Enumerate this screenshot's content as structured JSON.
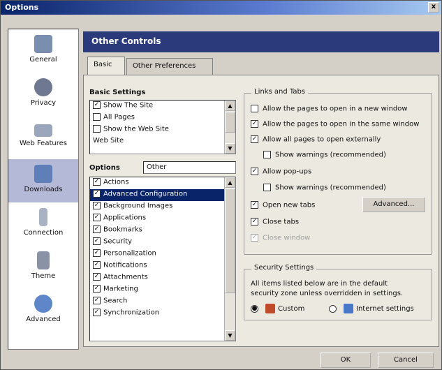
{
  "window": {
    "title": "Options",
    "close_glyph": "x"
  },
  "nav": {
    "items": [
      {
        "label": "General",
        "icon": "general-icon"
      },
      {
        "label": "Privacy",
        "icon": "privacy-icon"
      },
      {
        "label": "Web Features",
        "icon": "web-features-icon"
      },
      {
        "label": "Downloads",
        "icon": "downloads-icon",
        "selected": true
      },
      {
        "label": "Connection",
        "icon": "connection-icon"
      },
      {
        "label": "Theme",
        "icon": "theme-icon"
      },
      {
        "label": "Advanced",
        "icon": "advanced-icon"
      }
    ]
  },
  "header": {
    "title": "Other Controls"
  },
  "tabs": [
    {
      "label": "Basic"
    },
    {
      "label": "Other Preferences"
    }
  ],
  "left_section": {
    "basic_label": "Basic Settings",
    "basic_items": [
      {
        "label": "Show The Site",
        "checked": true
      },
      {
        "label": "All Pages",
        "checked": false
      },
      {
        "label": "Show the Web Site",
        "checked": false
      },
      {
        "label": "Web Site",
        "checked": false
      }
    ],
    "filter_label": "Options",
    "filter_value": "Other",
    "list_items": [
      {
        "label": "Actions",
        "checked": true
      },
      {
        "label": "Advanced Configuration",
        "checked": true,
        "selected": true
      },
      {
        "label": "Background Images",
        "checked": true
      },
      {
        "label": "Applications",
        "checked": true
      },
      {
        "label": "Bookmarks",
        "checked": true
      },
      {
        "label": "Security",
        "checked": true
      },
      {
        "label": "Personalization",
        "checked": true
      },
      {
        "label": "Notifications",
        "checked": true
      },
      {
        "label": "Attachments",
        "checked": true
      },
      {
        "label": "Marketing",
        "checked": true
      },
      {
        "label": "Search",
        "checked": true
      },
      {
        "label": "Synchronization",
        "checked": true
      }
    ]
  },
  "right_section": {
    "group1_label": "Links and Tabs",
    "options": [
      {
        "label": "Allow the pages to open in a new window",
        "checked": false,
        "indent": false,
        "disabled": false
      },
      {
        "label": "Allow the pages to open in the same window",
        "checked": true,
        "indent": false,
        "disabled": false
      },
      {
        "label": "Allow all pages to open externally",
        "checked": true,
        "indent": false,
        "disabled": false
      },
      {
        "label": "Show warnings (recommended)",
        "checked": false,
        "indent": true,
        "disabled": false
      },
      {
        "label": "Allow pop-ups",
        "checked": true,
        "indent": false,
        "disabled": false
      },
      {
        "label": "Show warnings (recommended)",
        "checked": false,
        "indent": true,
        "disabled": false
      },
      {
        "label": "Open new tabs",
        "checked": true,
        "indent": false,
        "disabled": false
      },
      {
        "label": "Close tabs",
        "checked": true,
        "indent": false,
        "disabled": false
      },
      {
        "label": "Close window",
        "checked": true,
        "indent": false,
        "disabled": true
      }
    ],
    "advanced_button": "Advanced...",
    "group2_label": "Security Settings",
    "group2_text1": "All items listed below are in the default",
    "group2_text2": "security zone unless overridden in settings.",
    "radio1_label": "Custom",
    "radio2_label": "Internet settings",
    "radio1_icon": "shield-icon",
    "radio2_icon": "globe-icon"
  },
  "footer": {
    "ok_label": "OK",
    "cancel_label": "Cancel"
  }
}
